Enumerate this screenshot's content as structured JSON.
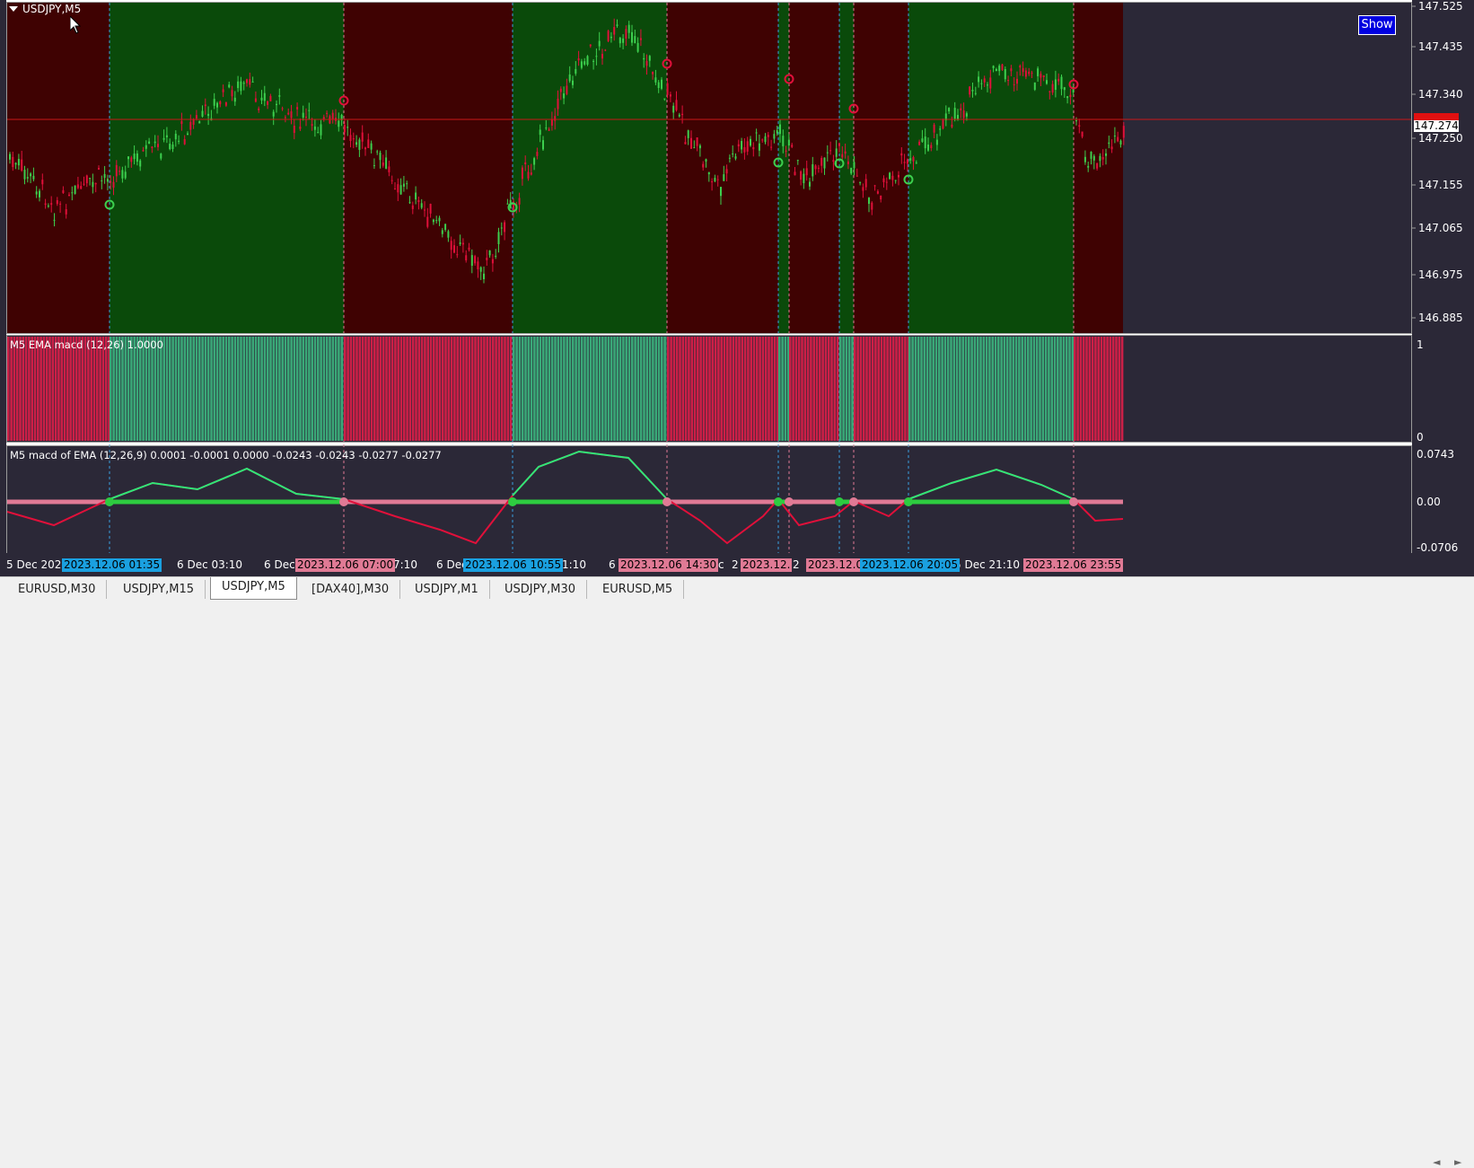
{
  "window": {
    "title": "USDJPY,M5"
  },
  "show_button": "Show",
  "colors": {
    "bull_zone": "#0a4a0a",
    "bear_zone": "#3f0202",
    "empty_bg": "#2b2837",
    "green": "#3ccf4e",
    "red": "#e0103a",
    "pink": "#e07a95",
    "blue_tag": "#1aa0e0"
  },
  "price_axis": {
    "ticks": [
      "147.525",
      "147.435",
      "147.340",
      "147.250",
      "147.155",
      "147.065",
      "146.975",
      "146.885"
    ],
    "current": "147.274"
  },
  "sub1": {
    "title": "M5 EMA macd (12,26) 1.0000",
    "axis": [
      "1",
      "0"
    ]
  },
  "sub2": {
    "title": "M5 macd of EMA (12,26,9) 0.0001 -0.0001 0.0000 -0.0243 -0.0243 -0.0277 -0.0277",
    "axis": [
      "0.0743",
      "0.00",
      "-0.0706"
    ]
  },
  "time_axis": {
    "labels": [
      "5 Dec 2023",
      "6 Dec 03:10",
      "6 Dec",
      "7:10",
      "6 Dec",
      "1:10",
      "6",
      "c",
      "2",
      "2",
      "5 Dec 21:10"
    ],
    "tags": [
      {
        "text": "2023.12.06 01:35",
        "kind": "blue"
      },
      {
        "text": "2023.12.06 07:00",
        "kind": "pink"
      },
      {
        "text": "2023.12.06 10:55",
        "kind": "blue"
      },
      {
        "text": "2023.12.06 14:30",
        "kind": "pink"
      },
      {
        "text": "2023.12.",
        "kind": "pink"
      },
      {
        "text": "2023.12.0",
        "kind": "pink"
      },
      {
        "text": "2023.12.06 20:05",
        "kind": "blue"
      },
      {
        "text": "2023.12.06 23:55",
        "kind": "pink"
      }
    ]
  },
  "tabs": [
    "EURUSD,M30",
    "USDJPY,M15",
    "USDJPY,M5",
    "[DAX40],M30",
    "USDJPY,M1",
    "USDJPY,M30",
    "EURUSD,M5"
  ],
  "active_tab": "USDJPY,M5",
  "nav": {
    "left": "◄",
    "right": "►"
  }
}
